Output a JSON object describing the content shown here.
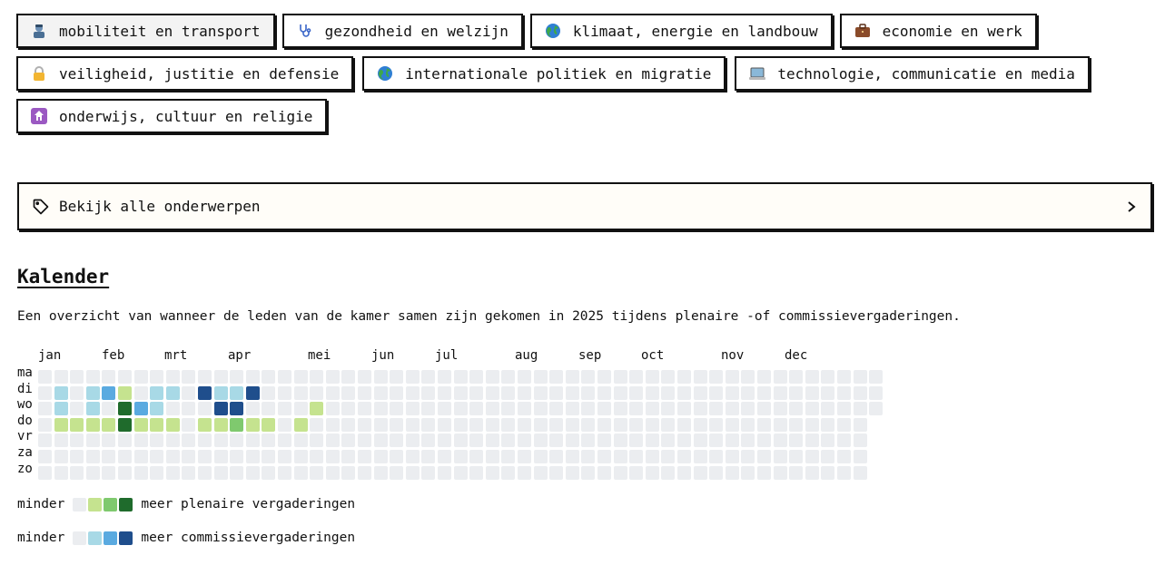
{
  "topics": [
    [
      {
        "label": "mobiliteit en transport",
        "icon": "mechanic-icon",
        "bg": "#e8e8e8"
      },
      {
        "label": "gezondheid en welzijn",
        "icon": "stethoscope-icon"
      },
      {
        "label": "klimaat, energie en landbouw",
        "icon": "globe-icon"
      },
      {
        "label": "economie en werk",
        "icon": "briefcase-icon"
      }
    ],
    [
      {
        "label": "veiligheid, justitie en defensie",
        "icon": "lock-icon"
      },
      {
        "label": "internationale politiek en migratie",
        "icon": "globe-icon"
      },
      {
        "label": "technologie, communicatie en media",
        "icon": "laptop-icon"
      }
    ],
    [
      {
        "label": "onderwijs, cultuur en religie",
        "icon": "place-of-worship-icon"
      }
    ]
  ],
  "all_topics_label": "Bekijk alle onderwerpen",
  "calendar": {
    "title": "Kalender",
    "description": "Een overzicht van wanneer de leden van de kamer samen zijn gekomen in 2025 tijdens plenaire -of commissievergaderingen.",
    "months": [
      "jan",
      "feb",
      "mrt",
      "apr",
      "mei",
      "jun",
      "jul",
      "aug",
      "sep",
      "oct",
      "nov",
      "dec"
    ],
    "days": [
      "ma",
      "di",
      "wo",
      "do",
      "vr",
      "za",
      "zo"
    ],
    "legend_less": "minder",
    "legend_more_plenary": "meer plenaire vergaderingen",
    "legend_more_committee": "meer commissievergaderingen",
    "colors": {
      "empty": "#ebedf0",
      "plenary": [
        "#c5e38f",
        "#7fc96e",
        "#1f6b2c"
      ],
      "committee": [
        "#a8d9e6",
        "#5aaae0",
        "#1f4e8c"
      ]
    },
    "cells": [
      {
        "week": 1,
        "day": 1,
        "c": "committee",
        "l": 0
      },
      {
        "week": 3,
        "day": 1,
        "c": "committee",
        "l": 0
      },
      {
        "week": 4,
        "day": 1,
        "c": "committee",
        "l": 1
      },
      {
        "week": 5,
        "day": 1,
        "c": "plenary",
        "l": 0
      },
      {
        "week": 7,
        "day": 1,
        "c": "committee",
        "l": 0
      },
      {
        "week": 8,
        "day": 1,
        "c": "committee",
        "l": 0
      },
      {
        "week": 10,
        "day": 1,
        "c": "committee",
        "l": 2
      },
      {
        "week": 11,
        "day": 1,
        "c": "committee",
        "l": 0
      },
      {
        "week": 12,
        "day": 1,
        "c": "committee",
        "l": 0
      },
      {
        "week": 13,
        "day": 1,
        "c": "committee",
        "l": 2
      },
      {
        "week": 1,
        "day": 2,
        "c": "committee",
        "l": 0
      },
      {
        "week": 3,
        "day": 2,
        "c": "committee",
        "l": 0
      },
      {
        "week": 5,
        "day": 2,
        "c": "plenary",
        "l": 2
      },
      {
        "week": 6,
        "day": 2,
        "c": "committee",
        "l": 1
      },
      {
        "week": 7,
        "day": 2,
        "c": "committee",
        "l": 0
      },
      {
        "week": 11,
        "day": 2,
        "c": "committee",
        "l": 2
      },
      {
        "week": 12,
        "day": 2,
        "c": "committee",
        "l": 2
      },
      {
        "week": 17,
        "day": 2,
        "c": "plenary",
        "l": 0
      },
      {
        "week": 1,
        "day": 3,
        "c": "plenary",
        "l": 0
      },
      {
        "week": 2,
        "day": 3,
        "c": "plenary",
        "l": 0
      },
      {
        "week": 3,
        "day": 3,
        "c": "plenary",
        "l": 0
      },
      {
        "week": 4,
        "day": 3,
        "c": "plenary",
        "l": 0
      },
      {
        "week": 5,
        "day": 3,
        "c": "plenary",
        "l": 2
      },
      {
        "week": 6,
        "day": 3,
        "c": "plenary",
        "l": 0
      },
      {
        "week": 7,
        "day": 3,
        "c": "plenary",
        "l": 0
      },
      {
        "week": 8,
        "day": 3,
        "c": "plenary",
        "l": 0
      },
      {
        "week": 10,
        "day": 3,
        "c": "plenary",
        "l": 0
      },
      {
        "week": 11,
        "day": 3,
        "c": "plenary",
        "l": 0
      },
      {
        "week": 12,
        "day": 3,
        "c": "plenary",
        "l": 1
      },
      {
        "week": 13,
        "day": 3,
        "c": "plenary",
        "l": 0
      },
      {
        "week": 14,
        "day": 3,
        "c": "plenary",
        "l": 0
      },
      {
        "week": 16,
        "day": 3,
        "c": "plenary",
        "l": 0
      }
    ]
  }
}
